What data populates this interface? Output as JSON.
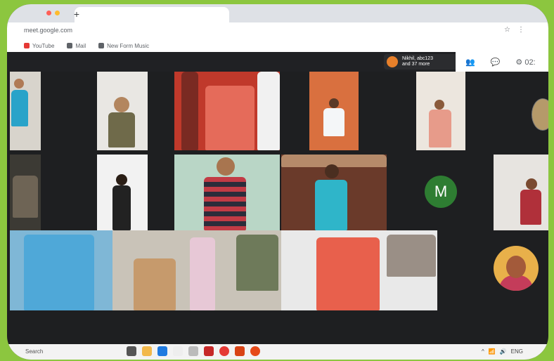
{
  "browser": {
    "url": "meet.google.com",
    "new_tab_symbol": "+",
    "controls": [
      "☆",
      "⋮"
    ],
    "bookmarks": [
      {
        "label": "YouTube",
        "color": "#e53935"
      },
      {
        "label": "Mail",
        "color": "#5f6368"
      },
      {
        "label": "New Form Music",
        "color": "#5f6368"
      }
    ]
  },
  "meet": {
    "presenter_line1": "Nikhil, abc123",
    "presenter_line2": "and 37 more",
    "actions": [
      "👥",
      "💬",
      "⚙ 02:"
    ]
  },
  "participants": {
    "initial_avatar": "M",
    "initial_avatar_color": "#2e7d32"
  },
  "taskbar": {
    "search": "Search",
    "tray": [
      "^",
      "📶",
      "🔊",
      "ENG"
    ]
  },
  "colors": {
    "background_green": "#8cc63f",
    "meet_dark": "#202124"
  }
}
